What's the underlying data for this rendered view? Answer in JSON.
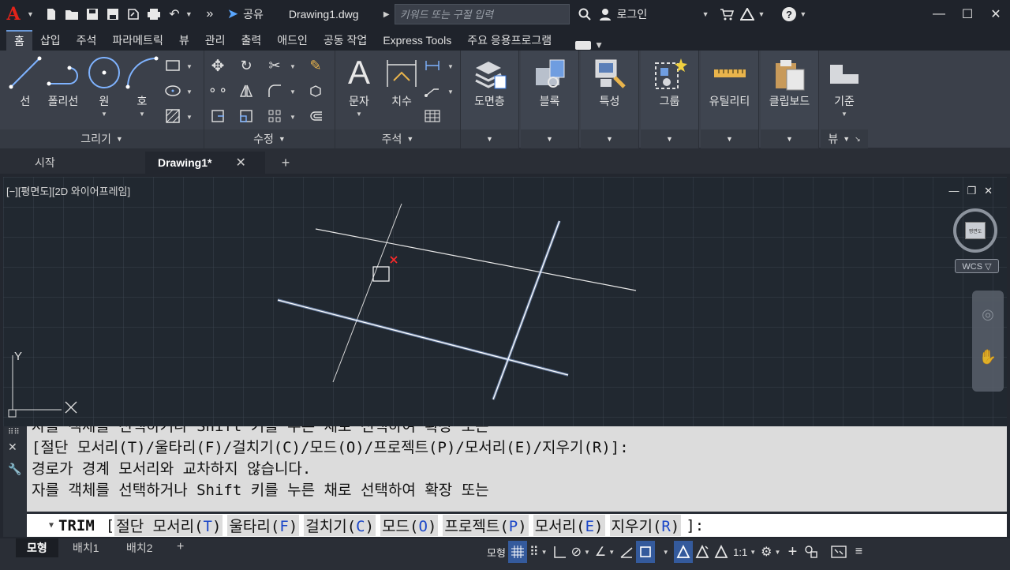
{
  "app": {
    "logo_letter": "A",
    "share_label": "공유",
    "document_title": "Drawing1.dwg",
    "search_placeholder": "키워드 또는 구절 입력",
    "login_label": "로그인",
    "colors": {
      "accent": "#345a9c",
      "logo": "#e2231a",
      "link_key": "#1a46c8"
    }
  },
  "ribbon_tabs": [
    "홈",
    "삽입",
    "주석",
    "파라메트릭",
    "뷰",
    "관리",
    "출력",
    "애드인",
    "공동 작업",
    "Express Tools",
    "주요 응용프로그램"
  ],
  "ribbon": {
    "draw": {
      "footer": "그리기",
      "tools": [
        "선",
        "폴리선",
        "원",
        "호"
      ]
    },
    "modify": {
      "footer": "수정"
    },
    "annotation": {
      "footer": "주석",
      "tools": [
        "문자",
        "치수"
      ]
    },
    "buttons": [
      "도면층",
      "블록",
      "특성",
      "그룹",
      "유틸리티",
      "클립보드"
    ],
    "base": {
      "label": "기준",
      "footer": "뷰"
    }
  },
  "file_tabs": {
    "start": "시작",
    "active": "Drawing1*"
  },
  "viewport": {
    "label": "[−][평면도][2D 와이어프레임]",
    "wcs_label": "WCS ▽",
    "ucs_y": "Y",
    "cube_face": "평면도"
  },
  "command": {
    "history": [
      "자를 객체를 선택하거나 Shift 키를 누른 채로 선택하여 확장 또는",
      " [절단 모서리(T)/울타리(F)/걸치기(C)/모드(O)/프로젝트(P)/모서리(E)/지우기(R)]:",
      "경로가 경계 모서리와 교차하지 않습니다.",
      "자를 객체를 선택하거나 Shift 키를 누른 채로 선택하여 확장 또는"
    ],
    "prompt_name": "TRIM",
    "open_bracket": "[",
    "close_bracket": "]:",
    "options": [
      {
        "label": "절단 모서리",
        "key": "T"
      },
      {
        "label": "울타리",
        "key": "F"
      },
      {
        "label": "걸치기",
        "key": "C"
      },
      {
        "label": "모드",
        "key": "O"
      },
      {
        "label": "프로젝트",
        "key": "P"
      },
      {
        "label": "모서리",
        "key": "E"
      },
      {
        "label": "지우기",
        "key": "R"
      }
    ]
  },
  "layout_tabs": [
    "모형",
    "배치1",
    "배치2"
  ],
  "status": {
    "model_label": "모형",
    "scale": "1:1"
  }
}
